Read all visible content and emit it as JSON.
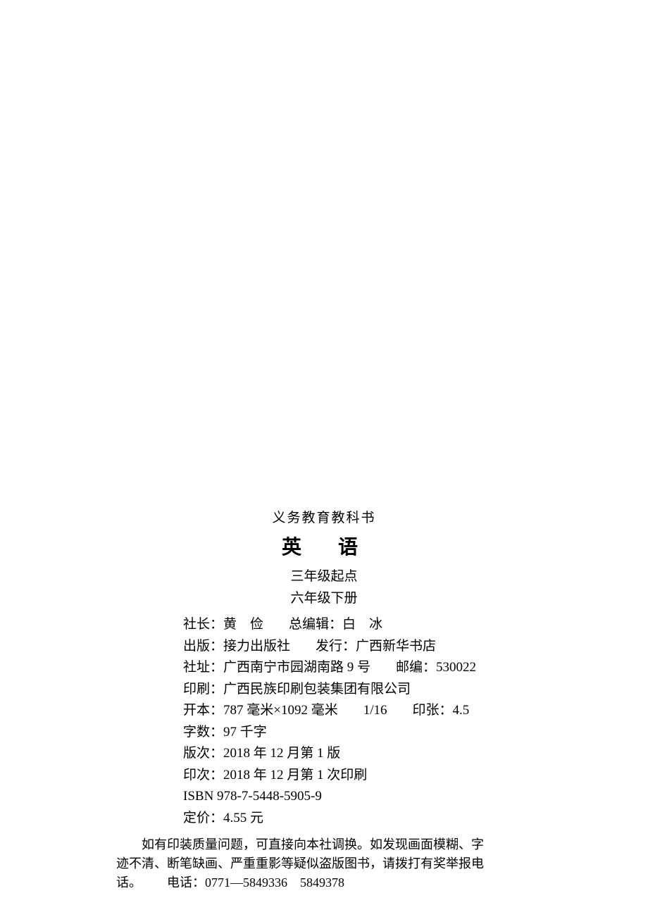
{
  "header": {
    "series": "义务教育教科书",
    "title": "英　语",
    "subtitle1": "三年级起点",
    "subtitle2": "六年级下册"
  },
  "details": {
    "director_label": "社长：",
    "director_name": "黄　俭",
    "editor_label": "总编辑：",
    "editor_name": "白　冰",
    "publisher_label": "出版：",
    "publisher_name": "接力出版社",
    "distributor_label": "发行：",
    "distributor_name": "广西新华书店",
    "address_label": "社址：",
    "address_value": "广西南宁市园湖南路 9 号",
    "postcode_label": "邮编：",
    "postcode_value": "530022",
    "printer_label": "印刷：",
    "printer_value": "广西民族印刷包装集团有限公司",
    "format_label": "开本：",
    "format_value": "787 毫米×1092 毫米",
    "format_ratio": "1/16",
    "sheets_label": "印张：",
    "sheets_value": "4.5",
    "words_label": "字数：",
    "words_value": "97 千字",
    "edition_label": "版次：",
    "edition_value": "2018 年 12 月第 1 版",
    "impression_label": "印次：",
    "impression_value": "2018 年 12 月第 1 次印刷",
    "isbn": "ISBN 978-7-5448-5905-9",
    "price_label": "定价：",
    "price_value": "4.55 元"
  },
  "notice": {
    "line1": "如有印装质量问题，可直接向本社调换。如发现画面模糊、字",
    "line2": "迹不清、断笔缺画、严重重影等疑似盗版图书，请拨打有奖举报电",
    "line3_prefix": "话。",
    "phone_label": "电话：",
    "phone_value": "0771—5849336　5849378"
  }
}
